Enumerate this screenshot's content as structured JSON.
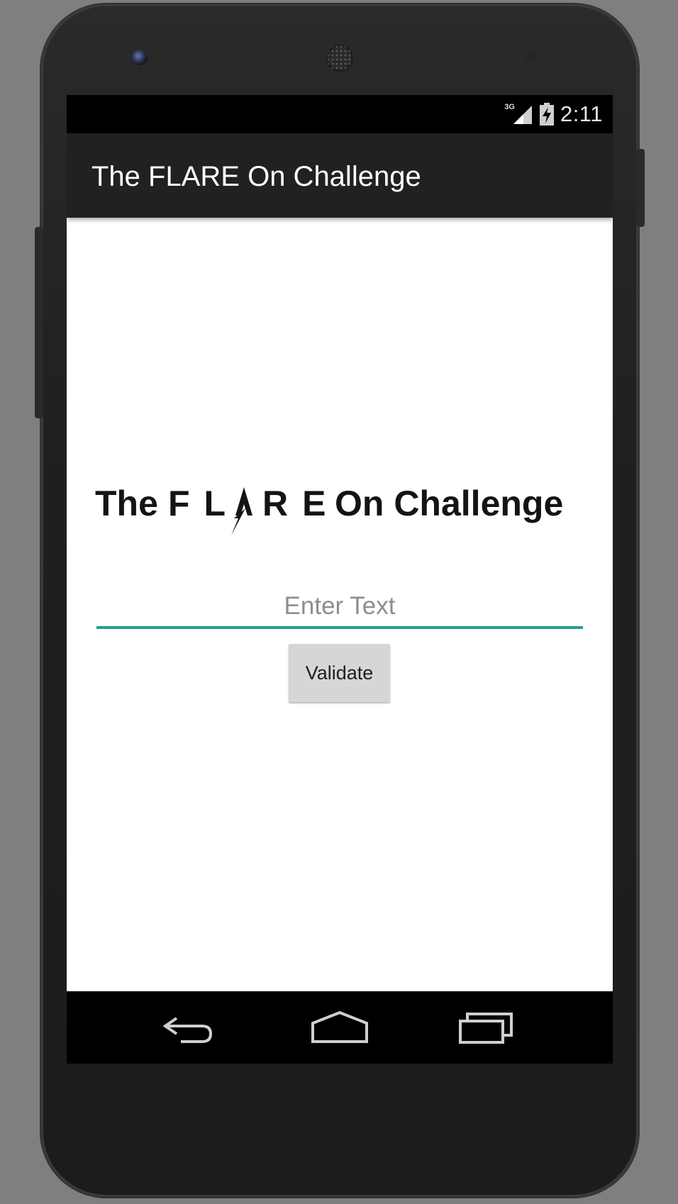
{
  "app_bar": {
    "title": "The FLARE On Challenge"
  },
  "status_bar": {
    "network": "3G",
    "time": "2:11"
  },
  "logo": {
    "text": "The FLARE On Challenge"
  },
  "form": {
    "input_placeholder": "Enter Text",
    "input_value": "",
    "validate_label": "Validate",
    "accent_color": "#1aa594"
  },
  "nav": {
    "back_icon": "back-icon",
    "home_icon": "home-icon",
    "recents_icon": "recents-icon"
  }
}
